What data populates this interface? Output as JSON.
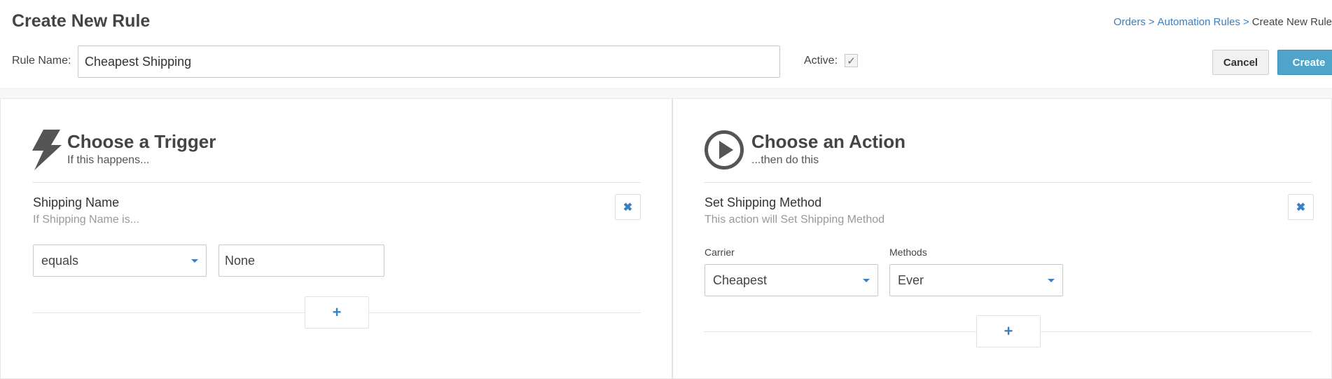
{
  "header": {
    "title": "Create New Rule",
    "breadcrumb": [
      {
        "label": "Orders"
      },
      {
        "label": "Automation Rules"
      },
      {
        "label": "Create New Rule"
      }
    ],
    "breadcrumb_separator": ">"
  },
  "form": {
    "rule_name_label": "Rule Name:",
    "rule_name_value": "Cheapest Shipping",
    "active_label": "Active:",
    "active_checked": true,
    "cancel_label": "Cancel",
    "create_label": "Create",
    "create_color": "#4ea5c9"
  },
  "trigger": {
    "icon": "lightning-bolt-icon",
    "title": "Choose a Trigger",
    "subtitle": "If this happens...",
    "item": {
      "title": "Shipping Name",
      "description": "If Shipping Name is...",
      "operator": "equals",
      "value": "None"
    },
    "add_label": "+"
  },
  "action": {
    "icon": "play-circle-icon",
    "title": "Choose an Action",
    "subtitle": "...then do this",
    "item": {
      "title": "Set Shipping Method",
      "description": "This action will Set Shipping Method",
      "carrier_label": "Carrier",
      "carrier_value": "Cheapest",
      "methods_label": "Methods",
      "methods_value": "Ever"
    },
    "add_label": "+"
  },
  "icons": {
    "remove": "close-icon",
    "check": "checkmark-icon"
  }
}
